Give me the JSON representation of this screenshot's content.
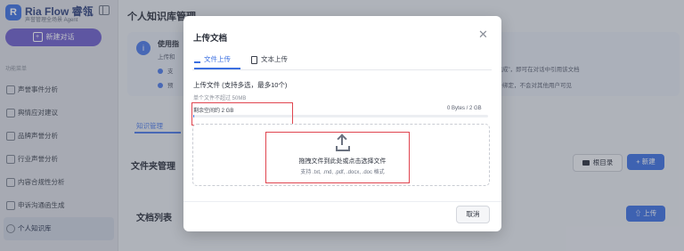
{
  "brand": {
    "name": "Ria Flow 睿瓴",
    "subtitle": "声誉管理全场景 Agent"
  },
  "sidebar": {
    "new_chat_label": "新建对话",
    "section_title": "功能菜单",
    "items": [
      {
        "label": "声誉事件分析"
      },
      {
        "label": "舆情应对建议"
      },
      {
        "label": "品牌声誉分析"
      },
      {
        "label": "行业声誉分析"
      },
      {
        "label": "内容合规性分析"
      },
      {
        "label": "申诉沟通函生成"
      },
      {
        "label": "个人知识库",
        "active": true
      }
    ]
  },
  "main": {
    "page_title": "个人知识库管理",
    "notice": {
      "title": "使用指",
      "line1": "上传和",
      "row1": "支",
      "row2": "预",
      "row1_right": "已完成”，即可在对话中引用该文档",
      "row2_right": "账号绑定，不会对其他用户可见"
    },
    "tab_kb": "知识管理",
    "folder_section_title": "文件夹管理",
    "root_button": "根目录",
    "new_button": "+ 新建",
    "doc_section_title": "文档列表",
    "upload_button": "上传"
  },
  "modal": {
    "title": "上传文档",
    "tabs": [
      {
        "label": "文件上传",
        "active": true
      },
      {
        "label": "文本上传"
      }
    ],
    "upload_label": "上传文件 (支持多选，最多10个)",
    "upload_sub": "单个文件不超过 50MB",
    "space_remaining": "剩余空间约 2 GB",
    "space_used": "0 Bytes / 2 GB",
    "space_used_fraction": 0.003,
    "dropzone_main": "拖拽文件到此处或点击选择文件",
    "dropzone_sub": "支持 .txt, .md, .pdf, .docx, .doc 格式",
    "cancel_label": "取消"
  },
  "colors": {
    "accent": "#3b6fe0",
    "brand_purple": "#6c5cc9",
    "highlight_red": "#e0454f"
  },
  "icons": [
    "sidebar-collapse-icon",
    "plus-icon",
    "info-icon",
    "check-icon",
    "folder-icon",
    "close-icon",
    "upload-icon",
    "document-icon"
  ]
}
